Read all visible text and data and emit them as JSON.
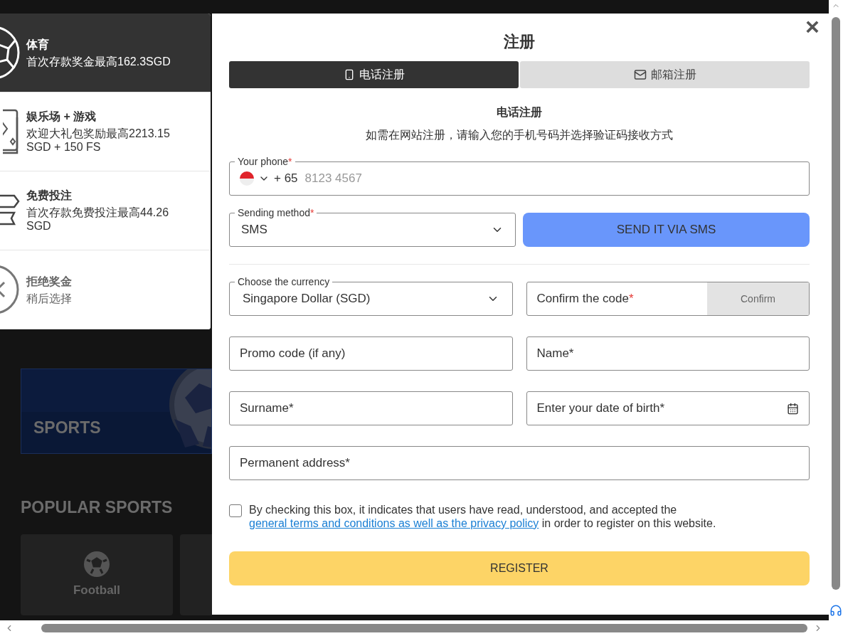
{
  "background": {
    "banner": {
      "title": "SPORTS"
    },
    "section_title": "POPULAR SPORTS",
    "sport_cards": [
      {
        "kind": "full",
        "label": "Football"
      },
      {
        "kind": "partial"
      }
    ]
  },
  "bonus_panel": {
    "items": [
      {
        "kind": "ball",
        "title": "体育",
        "subtitle": "首次存款奖金最高162.3SGD",
        "selected": true
      },
      {
        "kind": "cards",
        "title": "娱乐场 + 游戏",
        "subtitle": "欢迎大礼包奖励最高2213.15 SGD + 150 FS",
        "selected": false
      },
      {
        "kind": "ticket",
        "title": "免费投注",
        "subtitle": "首次存款免费投注最高44.26 SGD",
        "selected": false
      },
      {
        "kind": "decline",
        "title": "拒绝奖金",
        "subtitle": "稍后选择",
        "selected": false
      }
    ]
  },
  "dialog": {
    "title": "注册",
    "close": "×",
    "tabs": [
      {
        "kind": "phone",
        "label": "电话注册",
        "selected": true
      },
      {
        "kind": "mail",
        "label": "邮箱注册",
        "selected": false
      }
    ],
    "heading": "电话注册",
    "intro": "如需在网站注册，请输入您的手机号码并选择验证码接收方式",
    "phone": {
      "label": "Your phone",
      "mark": "*",
      "code": "+ 65",
      "placeholder": "8123 4567"
    },
    "sending_method": {
      "label": "Sending method",
      "mark": "*",
      "value": "SMS"
    },
    "send_button": "SEND IT VIA SMS",
    "currency": {
      "label": "Choose the currency",
      "value": "Singapore Dollar (SGD)"
    },
    "confirm_code": {
      "placeholder": "Confirm the code",
      "mark": "*",
      "button": "Confirm"
    },
    "fields": [
      {
        "kind": "text",
        "placeholder": "Promo code (if any)"
      },
      {
        "kind": "text",
        "placeholder": "Name*"
      },
      {
        "kind": "text",
        "placeholder": "Surname*"
      },
      {
        "kind": "date",
        "placeholder": "Enter your date of birth*"
      },
      {
        "kind": "wide",
        "placeholder": "Permanent address*"
      }
    ],
    "agreement": {
      "checked": false,
      "before": "By checking this box, it indicates that users have read, understood, and accepted the",
      "link": "general terms and conditions as well as the privacy policy",
      "after": "in order to register on this website."
    },
    "register_button": "REGISTER"
  }
}
